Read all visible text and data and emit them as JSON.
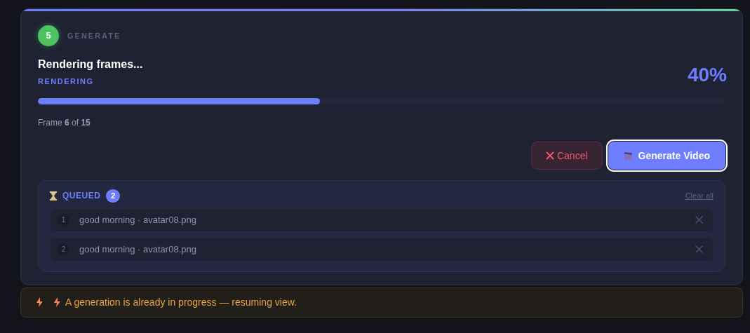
{
  "step": {
    "number": "5",
    "label": "GENERATE"
  },
  "status": {
    "title": "Rendering frames...",
    "phase": "RENDERING",
    "percent": "40%",
    "level": 0.41,
    "frame_text": "Frame **6** of **15**"
  },
  "buttons": [
    {
      "kind": "cancel",
      "label": "Cancel"
    },
    {
      "kind": "primary",
      "label": "Generate Video"
    }
  ],
  "queue": {
    "title": "QUEUED",
    "count": "2",
    "clear_label": "Clear all",
    "items": [
      {
        "index": "1",
        "text": "good morning · avatar08.png"
      },
      {
        "index": "2",
        "text": "good morning · avatar08.png"
      }
    ]
  },
  "alert": {
    "text": "A generation is already in progress — resuming view."
  }
}
